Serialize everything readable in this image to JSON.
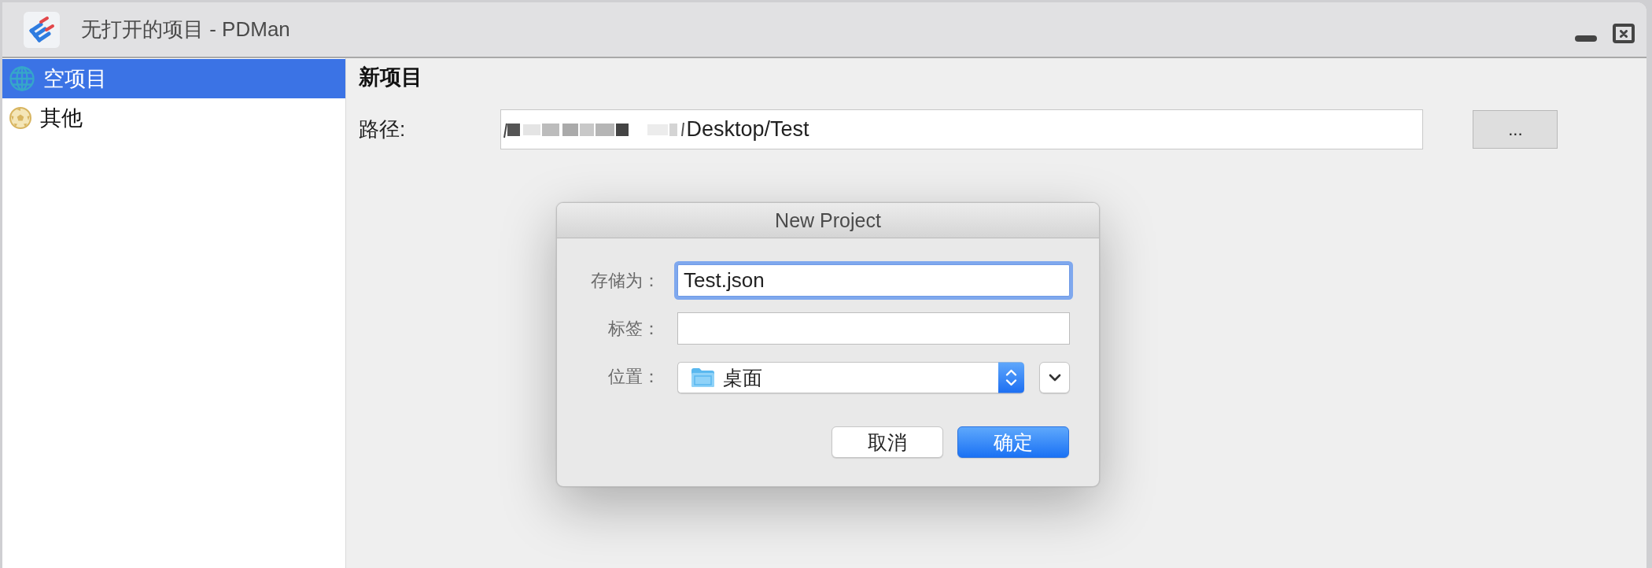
{
  "window": {
    "title": "无打开的项目 - PDMan"
  },
  "sidebar": {
    "items": [
      {
        "label": "空项目",
        "selected": true
      },
      {
        "label": "其他",
        "selected": false
      }
    ]
  },
  "main": {
    "heading": "新项目",
    "path": {
      "label": "路径:",
      "value": "Desktop/Test"
    },
    "browse_button": "..."
  },
  "dialog": {
    "title": "New Project",
    "fields": [
      {
        "kind": "text",
        "label": "存储为：",
        "value": "Test.json",
        "focused": true
      },
      {
        "kind": "text",
        "label": "标签：",
        "focused": false
      },
      {
        "kind": "popup",
        "label": "位置：",
        "value": "桌面"
      }
    ],
    "buttons": [
      {
        "label": "取消",
        "default": false
      },
      {
        "label": "确定",
        "default": true
      }
    ]
  }
}
